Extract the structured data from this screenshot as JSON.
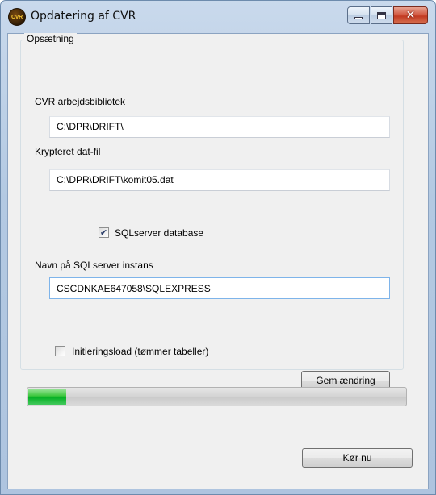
{
  "window": {
    "title": "Opdatering af CVR",
    "app_icon_text": "CVR",
    "buttons": {
      "minimize": "minimize-icon",
      "maximize": "maximize-icon",
      "close": "close-icon",
      "close_glyph": "✕"
    }
  },
  "setup": {
    "group_label": "Opsætning",
    "workdir_label": "CVR arbejdsbibliotek",
    "workdir_value": "C:\\DPR\\DRIFT\\",
    "datfile_label": "Krypteret dat-fil",
    "datfile_value": "C:\\DPR\\DRIFT\\komit05.dat",
    "sqlserver_checkbox_label": "SQLserver database",
    "sqlserver_checked": true,
    "instance_label": "Navn på SQLserver instans",
    "instance_value": "CSCDNKAE647058\\SQLEXPRESS",
    "init_checkbox_label": "Initieringsload (tømmer tabeller)",
    "init_checked": false,
    "save_button": "Gem ændring"
  },
  "progress": {
    "value_percent": 10
  },
  "run_button": "Kør nu",
  "colors": {
    "progress_green": "#06b025",
    "close_red": "#c23a22"
  }
}
